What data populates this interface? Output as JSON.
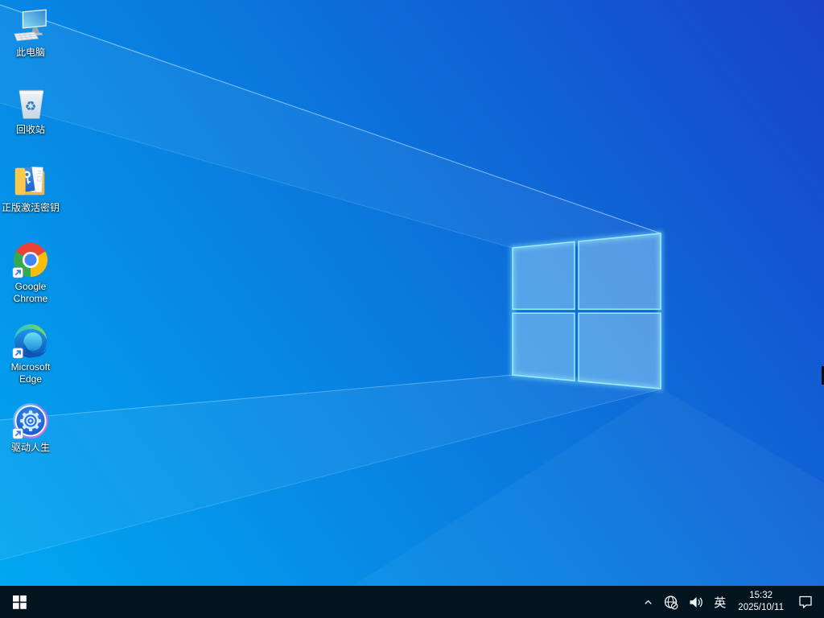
{
  "wallpaper": {
    "style": "windows10-light-rays",
    "gradient": {
      "bottom_left": "#00a9f2",
      "middle": "#0a7ade",
      "top_right": "#1843c8"
    },
    "logo": {
      "pane_fill": "rgba(195,242,255,0.40)",
      "edge_glow": "#9beff8"
    }
  },
  "desktop_icons": [
    {
      "id": "this-pc",
      "label": "此电脑"
    },
    {
      "id": "recycle-bin",
      "label": "回收站"
    },
    {
      "id": "activation-key",
      "label": "正版激活密钥"
    },
    {
      "id": "chrome",
      "label": "Google Chrome"
    },
    {
      "id": "edge",
      "label": "Microsoft Edge"
    },
    {
      "id": "driver-life",
      "label": "驱动人生"
    }
  ],
  "taskbar": {
    "color": "#04141e",
    "start_icon": "windows-logo",
    "tray": {
      "chevron_icon": "chevron-up-hidden-icons",
      "network_icon": "globe-no-internet",
      "volume_icon": "speaker-sound-on",
      "ime": "英",
      "time": "15:32",
      "date": "2025/10/11",
      "notification_icon": "action-center-bubble"
    }
  }
}
